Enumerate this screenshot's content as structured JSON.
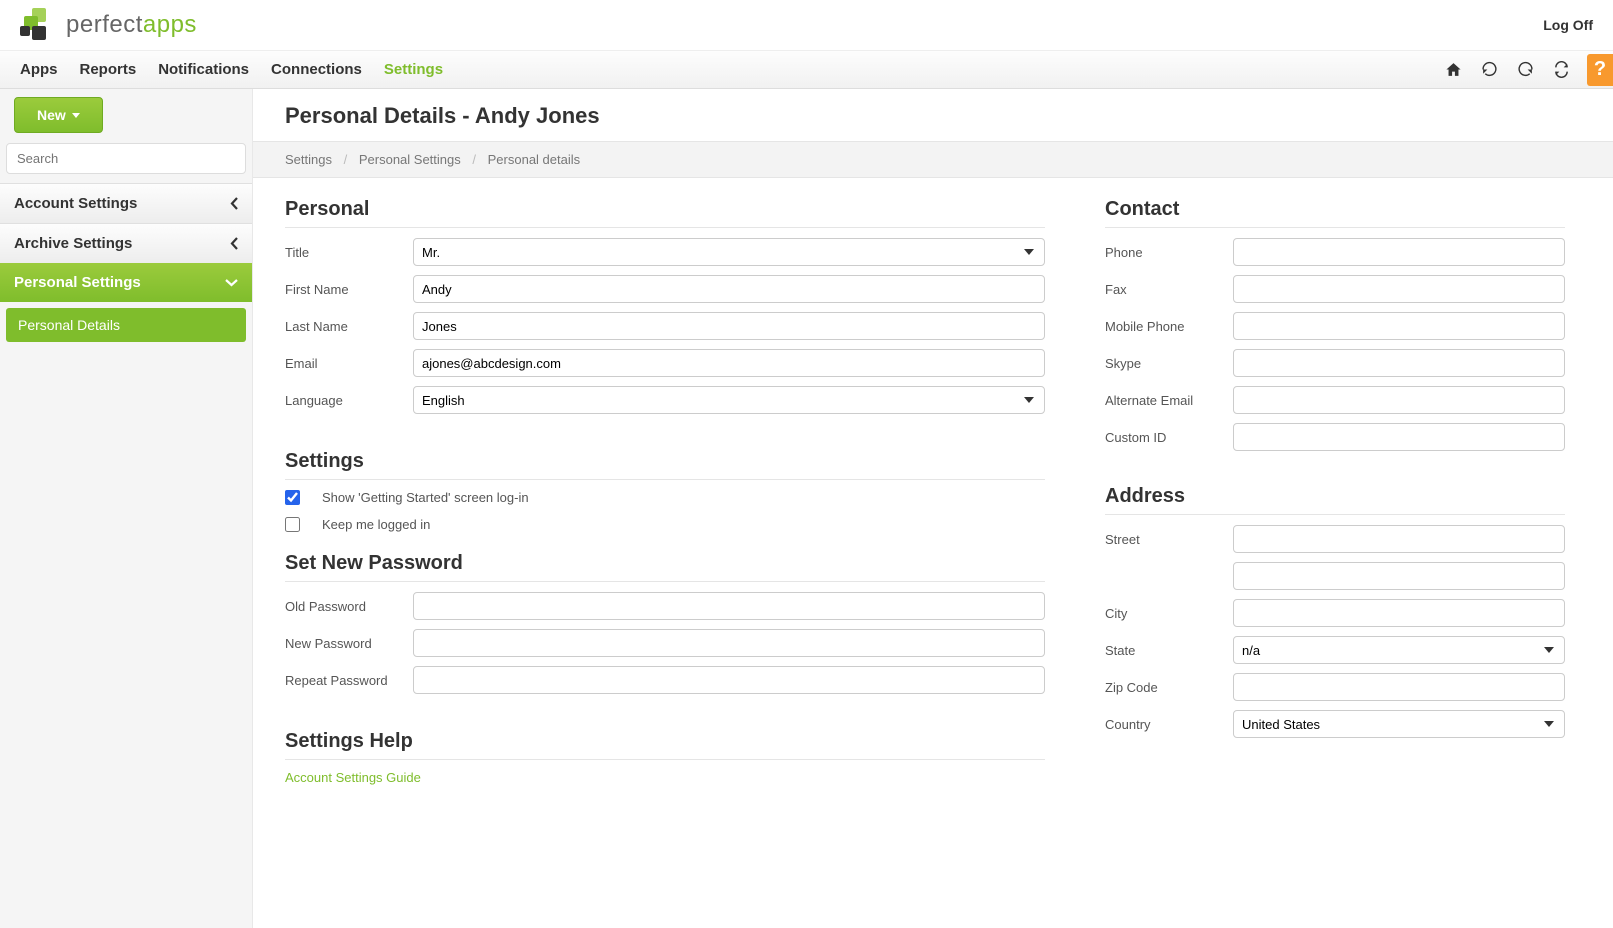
{
  "header": {
    "logo_text_a": "perfect",
    "logo_text_b": "apps",
    "logoff": "Log Off"
  },
  "nav": {
    "items": [
      "Apps",
      "Reports",
      "Notifications",
      "Connections",
      "Settings"
    ],
    "active": "Settings"
  },
  "sidebar": {
    "new_label": "New",
    "search_placeholder": "Search",
    "account": "Account Settings",
    "archive": "Archive Settings",
    "personal": "Personal Settings",
    "sub_personal": "Personal Details"
  },
  "page": {
    "title": "Personal Details - Andy Jones"
  },
  "breadcrumb": {
    "a": "Settings",
    "b": "Personal Settings",
    "c": "Personal details"
  },
  "personal": {
    "heading": "Personal",
    "title_label": "Title",
    "title_value": "Mr.",
    "first_label": "First Name",
    "first_value": "Andy",
    "last_label": "Last Name",
    "last_value": "Jones",
    "email_label": "Email",
    "email_value": "ajones@abcdesign.com",
    "language_label": "Language",
    "language_value": "English"
  },
  "contact": {
    "heading": "Contact",
    "phone": "Phone",
    "fax": "Fax",
    "mobile": "Mobile Phone",
    "skype": "Skype",
    "alt_email": "Alternate Email",
    "custom_id": "Custom ID"
  },
  "settings": {
    "heading": "Settings",
    "getting_started": "Show 'Getting Started' screen log-in",
    "keep_logged": "Keep me logged in"
  },
  "password": {
    "heading": "Set New Password",
    "old": "Old Password",
    "new": "New Password",
    "repeat": "Repeat Password"
  },
  "address": {
    "heading": "Address",
    "street": "Street",
    "city": "City",
    "state": "State",
    "state_value": "n/a",
    "zip": "Zip Code",
    "country": "Country",
    "country_value": "United States"
  },
  "help": {
    "heading": "Settings Help",
    "link": "Account Settings Guide"
  }
}
